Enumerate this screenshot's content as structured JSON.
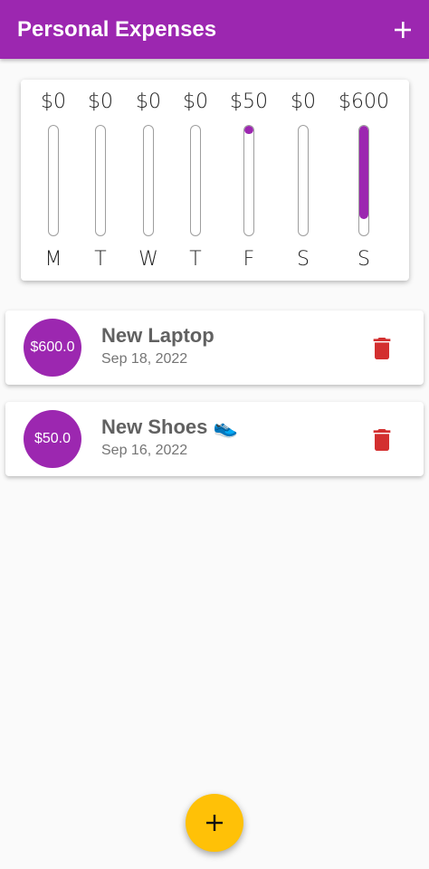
{
  "appbar": {
    "title": "Personal Expenses",
    "add_icon": "plus-icon",
    "background": "#9c27b0"
  },
  "chart_data": {
    "type": "bar",
    "categories": [
      "M",
      "T",
      "W",
      "T",
      "F",
      "S",
      "S"
    ],
    "values": [
      0,
      0,
      0,
      0,
      50,
      0,
      600
    ],
    "value_labels": [
      "$0",
      "$0",
      "$0",
      "$0",
      "$50",
      "$0",
      "$600"
    ],
    "max_total": 650,
    "bar_color": "#9c27b0"
  },
  "transactions": [
    {
      "amount_label": "$600.0",
      "title": "New Laptop",
      "date": "Sep 18, 2022",
      "delete_icon": "trash-icon"
    },
    {
      "amount_label": "$50.0",
      "title": "New Shoes 👟",
      "date": "Sep 16, 2022",
      "delete_icon": "trash-icon"
    }
  ],
  "fab": {
    "icon": "plus-icon",
    "color": "#ffc107"
  },
  "colors": {
    "primary": "#9c27b0",
    "accent": "#ffc107",
    "delete": "#d32f2f"
  }
}
